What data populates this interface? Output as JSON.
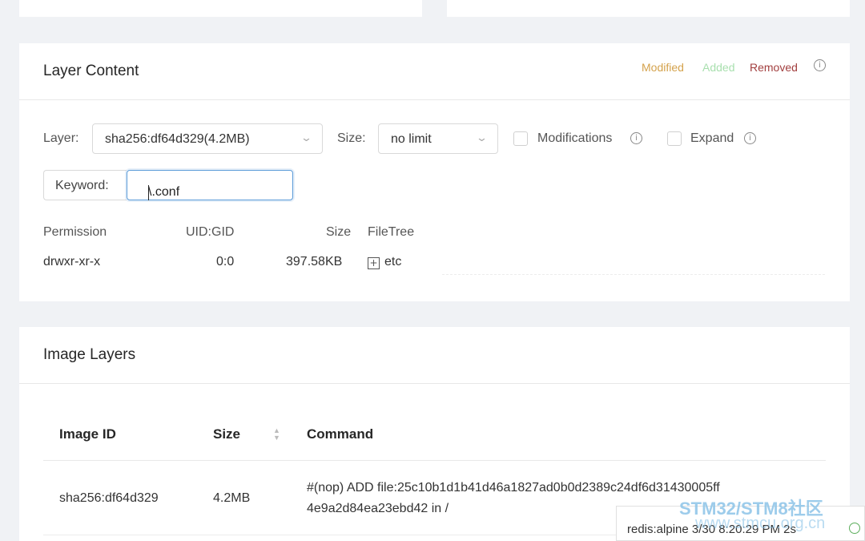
{
  "layer_content": {
    "title": "Layer Content",
    "legend": {
      "modified": "Modified",
      "added": "Added",
      "removed": "Removed"
    },
    "filters": {
      "layer_label": "Layer:",
      "layer_value": "sha256:df64d329(4.2MB)",
      "size_label": "Size:",
      "size_value": "no limit",
      "modifications_label": "Modifications",
      "expand_label": "Expand",
      "keyword_label": "Keyword:",
      "keyword_value": "\\.conf"
    },
    "table": {
      "headers": {
        "permission": "Permission",
        "uid_gid": "UID:GID",
        "size": "Size",
        "filetree": "FileTree"
      },
      "rows": [
        {
          "permission": "drwxr-xr-x",
          "uid_gid": "0:0",
          "size": "397.58KB",
          "name": "etc"
        }
      ]
    }
  },
  "image_layers": {
    "title": "Image Layers",
    "headers": {
      "image_id": "Image ID",
      "size": "Size",
      "command": "Command"
    },
    "rows": [
      {
        "image_id": "sha256:df64d329",
        "size": "4.2MB",
        "command_line1": "#(nop) ADD file:25c10b1d1b41d46a1827ad0b0d2389c24df6d31430005ff",
        "command_line2": "4e9a2d84ea23ebd42 in /"
      }
    ]
  },
  "status": {
    "text": "redis:alpine 3/30 8:20:29 PM 2s"
  },
  "watermark": {
    "line1": "STM32/STM8社区",
    "line2": "www.stmcu.org.cn"
  },
  "colors": {
    "modified": "#d4a24c",
    "added": "#a8dfae",
    "removed": "#a23f3f",
    "focus": "#5b9bd8"
  }
}
